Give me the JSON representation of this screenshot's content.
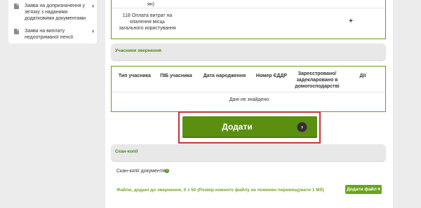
{
  "sidebar": {
    "items": [
      {
        "label": "Заява на допризначення у зв'язку з наданими додатковими документами"
      },
      {
        "label": "Заява на виплату недоотриманої пенсії"
      }
    ]
  },
  "services_table": {
    "top_fragment": "ян)",
    "row_label": "118 Оплата витрат на опалення місць загального користування",
    "plus_glyph": "+"
  },
  "participants": {
    "section_title": "Учасники звернення",
    "columns": [
      "Тип учасника",
      "ПІБ учасника",
      "Дата народження",
      "Номер ЄДДР",
      "Зареєстровано/ задекларовано в домогосподарстві",
      "Дії"
    ],
    "empty_text": "Дані не знайдено"
  },
  "add_button": {
    "label": "Додати",
    "arrow": "›"
  },
  "scans": {
    "section_title": "Скан-копії",
    "label": "Скан-копії документів",
    "info_glyph": "i",
    "files_text": "Файли, додані до звернення, 0 з 50 (Розмір кожного файлу не повинен перевищувати 1 Мб)",
    "add_file_label": "Додати файл ▾"
  },
  "colors": {
    "accent": "#5b8f10",
    "green_border": "#5fa31c",
    "highlight": "#c8313c"
  }
}
